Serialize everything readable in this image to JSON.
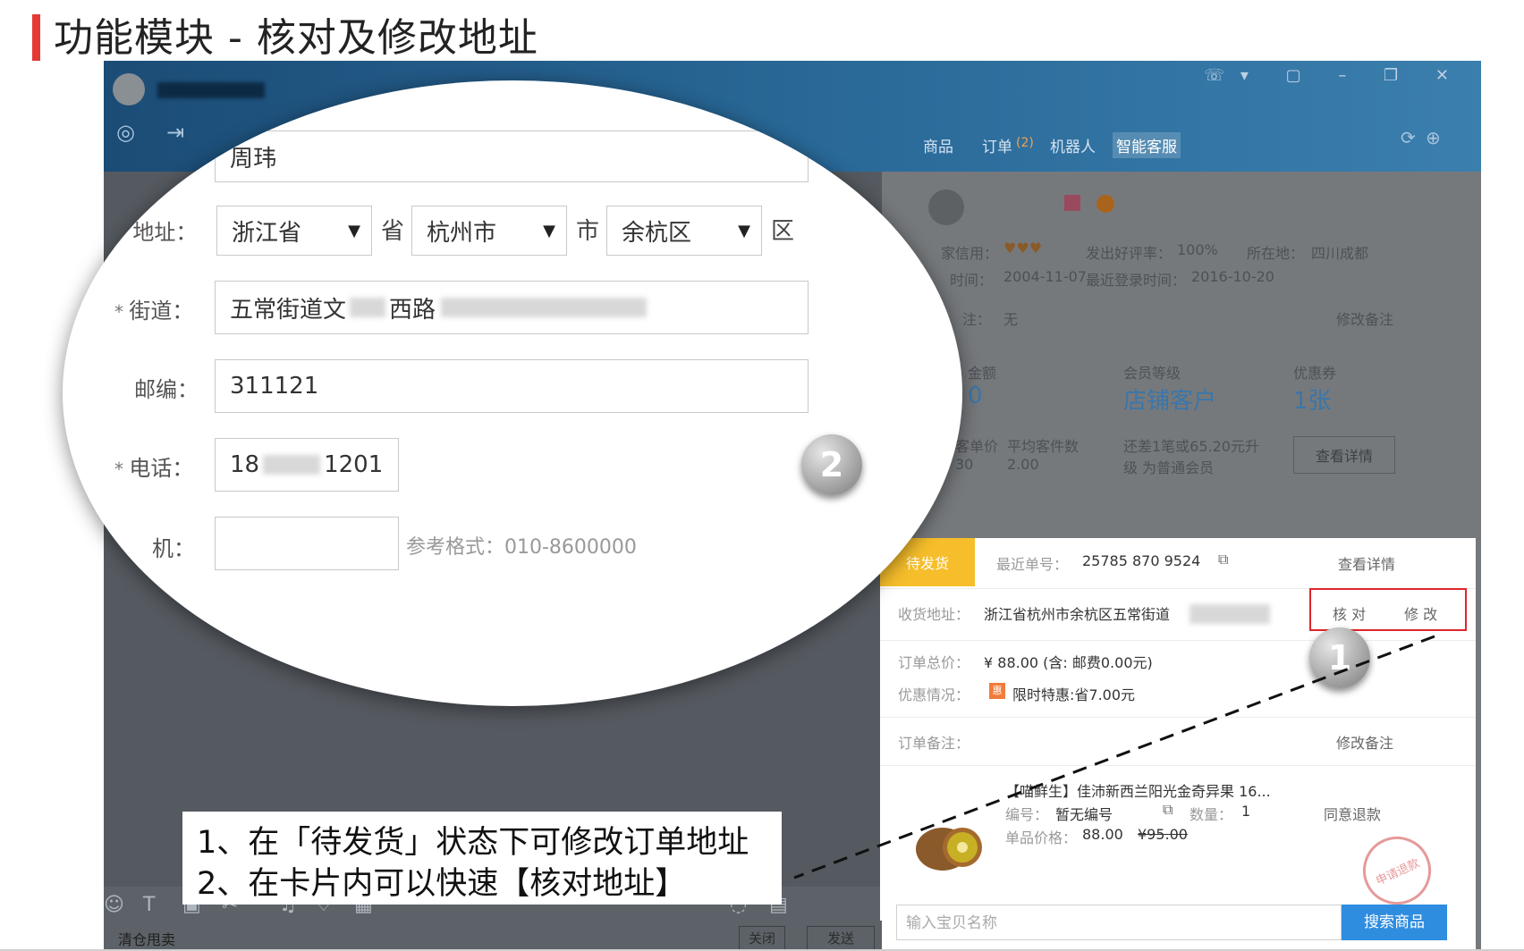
{
  "slide": {
    "title": "功能模块 - 核对及修改地址"
  },
  "header": {
    "tabs": [
      {
        "label": "商品"
      },
      {
        "label": "订单"
      },
      {
        "label": "(2)"
      },
      {
        "label": "机器人"
      },
      {
        "label": "智能客服"
      }
    ]
  },
  "customer_info": {
    "credit_label": "家信用：",
    "good_rate_label": "发出好评率：",
    "good_rate": "100%",
    "location_label": "所在地：",
    "location": "四川成都",
    "reg_label": "时间：",
    "reg_date": "2004-11-07",
    "last_login_label": "最近登录时间：",
    "last_login": "2016-10-20",
    "note_label": "注：",
    "note_value": "无",
    "edit_note": "修改备注",
    "amount_label": "金额",
    "amount_value": "0",
    "level_label": "会员等级",
    "level_value": "店铺客户",
    "coupon_label": "优惠券",
    "coupon_value": "1张",
    "unit_price_label": "客单价",
    "unit_price_value": "30",
    "avg_items_label": "平均客件数",
    "avg_items_value": "2.00",
    "upgrade_tip_1": "还差1笔或65.20元升",
    "upgrade_tip_2": "级 为普通会员",
    "details_button": "查看详情"
  },
  "order_card": {
    "status": "待发货",
    "order_no_label": "最近单号：",
    "order_no": "25785 870 9524",
    "view_details": "查看详情",
    "address_label": "收货地址：",
    "address_value": "浙江省杭州市余杭区五常街道",
    "verify": "核 对",
    "modify": "修 改",
    "total_label": "订单总价：",
    "total_value": "¥ 88.00 (含: 邮费0.00元)",
    "discount_label": "优惠情况：",
    "discount_icon": "惠",
    "discount_value": "限时特惠:省7.00元",
    "remark_label": "订单备注：",
    "edit_remark": "修改备注",
    "product_title": "【喵鲜生】佳沛新西兰阳光金奇异果 16...",
    "code_label": "编号：",
    "code_value": "暂无编号",
    "qty_label": "数量：",
    "qty_value": "1",
    "price_label": "单品价格：",
    "price_value": "88.00",
    "orig_price": "¥95.00",
    "refund": "同意退款",
    "stamp_text": "申请退款",
    "search_placeholder": "输入宝贝名称",
    "search_button": "搜索商品"
  },
  "address_form": {
    "name_value": "周玮",
    "region_label": "地址：",
    "province": "浙江省",
    "province_unit": "省",
    "city": "杭州市",
    "city_unit": "市",
    "district": "余杭区",
    "district_unit": "区",
    "street_label": "街道：",
    "street_value_start": "五常街道文",
    "street_value_mid": "西路",
    "zip_label": "邮编：",
    "zip_value": "311121",
    "phone_label": "电话：",
    "phone_start": "18",
    "phone_end": "1201",
    "mobile_label": "机：",
    "mobile_hint": "参考格式：010-8600000"
  },
  "badges": {
    "one": "1",
    "two": "2"
  },
  "annotation": {
    "line1": "1、在「待发货」状态下可修改订单地址",
    "line2": "2、在卡片内可以快速【核对地址】"
  },
  "bottom": {
    "left_text": "清仓甩卖",
    "close": "关闭",
    "send": "发送"
  },
  "colors": {
    "accent_red": "#e53935",
    "status_yellow": "#f6be2a",
    "search_blue": "#2f8de0",
    "header_blue": "#1b4c76"
  }
}
